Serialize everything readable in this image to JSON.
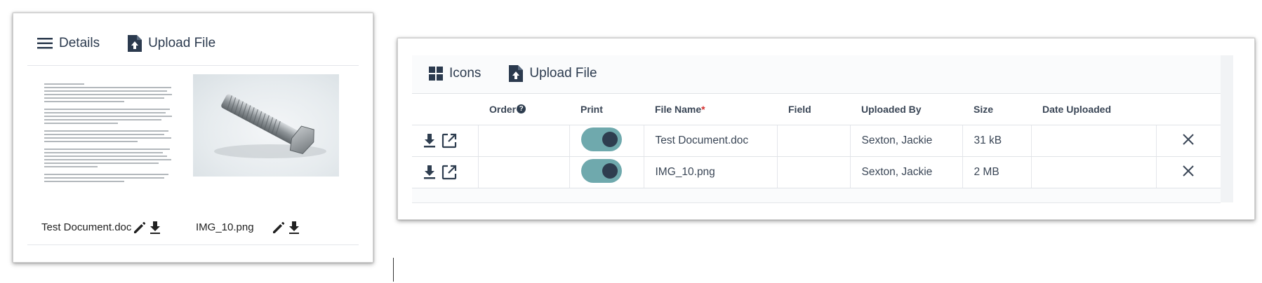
{
  "left_panel": {
    "toolbar": {
      "details_label": "Details",
      "upload_label": "Upload File"
    },
    "files": [
      {
        "name": "Test Document.doc",
        "type": "document"
      },
      {
        "name": "IMG_10.png",
        "type": "image"
      }
    ]
  },
  "right_panel": {
    "toolbar": {
      "icons_label": "Icons",
      "upload_label": "Upload File"
    },
    "columns": {
      "order": "Order",
      "print": "Print",
      "file_name": "File Name",
      "required_marker": "*",
      "field": "Field",
      "uploaded_by": "Uploaded By",
      "size": "Size",
      "date_uploaded": "Date Uploaded"
    },
    "help_glyph": "?",
    "rows": [
      {
        "order": "",
        "print": true,
        "file_name": "Test Document.doc",
        "field": "",
        "uploaded_by": "Sexton, Jackie",
        "size": "31 kB",
        "date_uploaded": ""
      },
      {
        "order": "",
        "print": true,
        "file_name": "IMG_10.png",
        "field": "",
        "uploaded_by": "Sexton, Jackie",
        "size": "2 MB",
        "date_uploaded": ""
      }
    ]
  },
  "icons": {
    "details": "hamburger-menu-icon",
    "upload": "file-upload-icon",
    "grid": "grid-icon",
    "edit": "pencil-icon",
    "download": "download-icon",
    "open": "open-external-icon",
    "remove": "close-icon",
    "help": "help-circle-icon"
  },
  "colors": {
    "toggle_track": "#6fa9ad",
    "toggle_knob": "#2e3d4f",
    "required": "#d32f2f",
    "text": "#2b3a4e"
  }
}
